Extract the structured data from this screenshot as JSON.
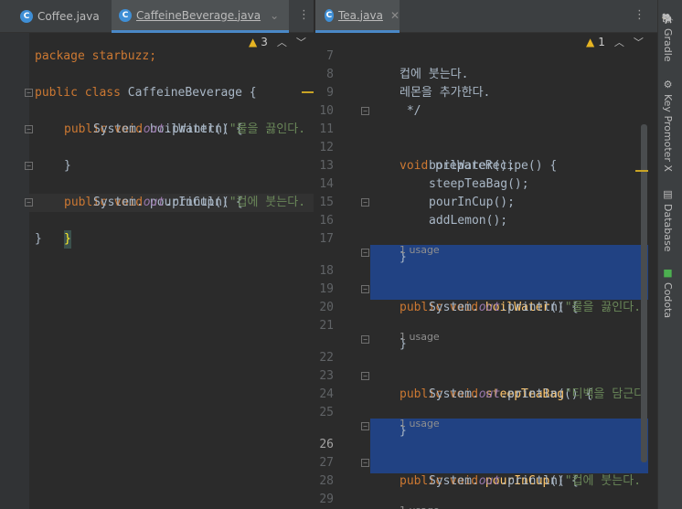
{
  "left_tabs": [
    {
      "label": "Coffee.java",
      "icon": "C",
      "active": false
    },
    {
      "label": "CaffeineBeverage.java",
      "icon": "C",
      "active": true
    }
  ],
  "right_tabs": [
    {
      "label": "Tea.java",
      "icon": "C",
      "active": true
    }
  ],
  "left_inspection": {
    "warnings": "3"
  },
  "right_inspection": {
    "warnings": "1"
  },
  "left_code": {
    "line1": "package starbuzz;",
    "class_kw": "public class ",
    "class_name": "CaffeineBeverage",
    "public_void": "public void ",
    "boil_name": "boilWater",
    "pour_name": "pourInCup",
    "parens_brace": "() {",
    "sys": "System.",
    "out": "out",
    "println": ".println(",
    "str_boil": "\"물을 끓인다.",
    "str_pour": "\"컵에 붓는다.",
    "close_brace": "}"
  },
  "right_code": {
    "ln7": "7",
    "ln8": "8",
    "ln9": "9",
    "ln10": "10",
    "ln11": "11",
    "ln12": "12",
    "ln13": "13",
    "ln14": "14",
    "ln15": "15",
    "ln16": "16",
    "ln17": "17",
    "ln18": "18",
    "ln19": "19",
    "ln20": "20",
    "ln21": "21",
    "ln22": "22",
    "ln23": "23",
    "ln24": "24",
    "ln25": "25",
    "ln26": "26",
    "ln27": "27",
    "ln28": "28",
    "ln29": "29",
    "c7": "컵에 붓는다.",
    "c8": "레몬을 추가한다.",
    "c9": " */",
    "void_kw": "void ",
    "prepare": "prepareRecipe",
    "call_boil": "boilWater();",
    "call_steep": "steepTeaBag();",
    "call_pour": "pourInCup();",
    "call_lemon": "addLemon();",
    "usage": "1 usage",
    "public_void": "public void ",
    "boil_name": "boilWater",
    "steep_name": "steepTeaBag",
    "pour_name": "pourInCup",
    "parens_brace": "() {",
    "sys": "System.",
    "out": "out",
    "println": ".println(",
    "str_boil": "\"물을 끓인다.",
    "str_steep": "\"티백을 담근다",
    "str_pour": "\"컵에 붓는다.",
    "close_brace": "}"
  },
  "tool_windows": [
    "Gradle",
    "Key Promoter X",
    "Database",
    "Codota"
  ],
  "colors": {
    "keyword": "#cc7832",
    "method": "#ffc66d",
    "string": "#6a8759",
    "field": "#9876aa",
    "selection": "#214283"
  }
}
